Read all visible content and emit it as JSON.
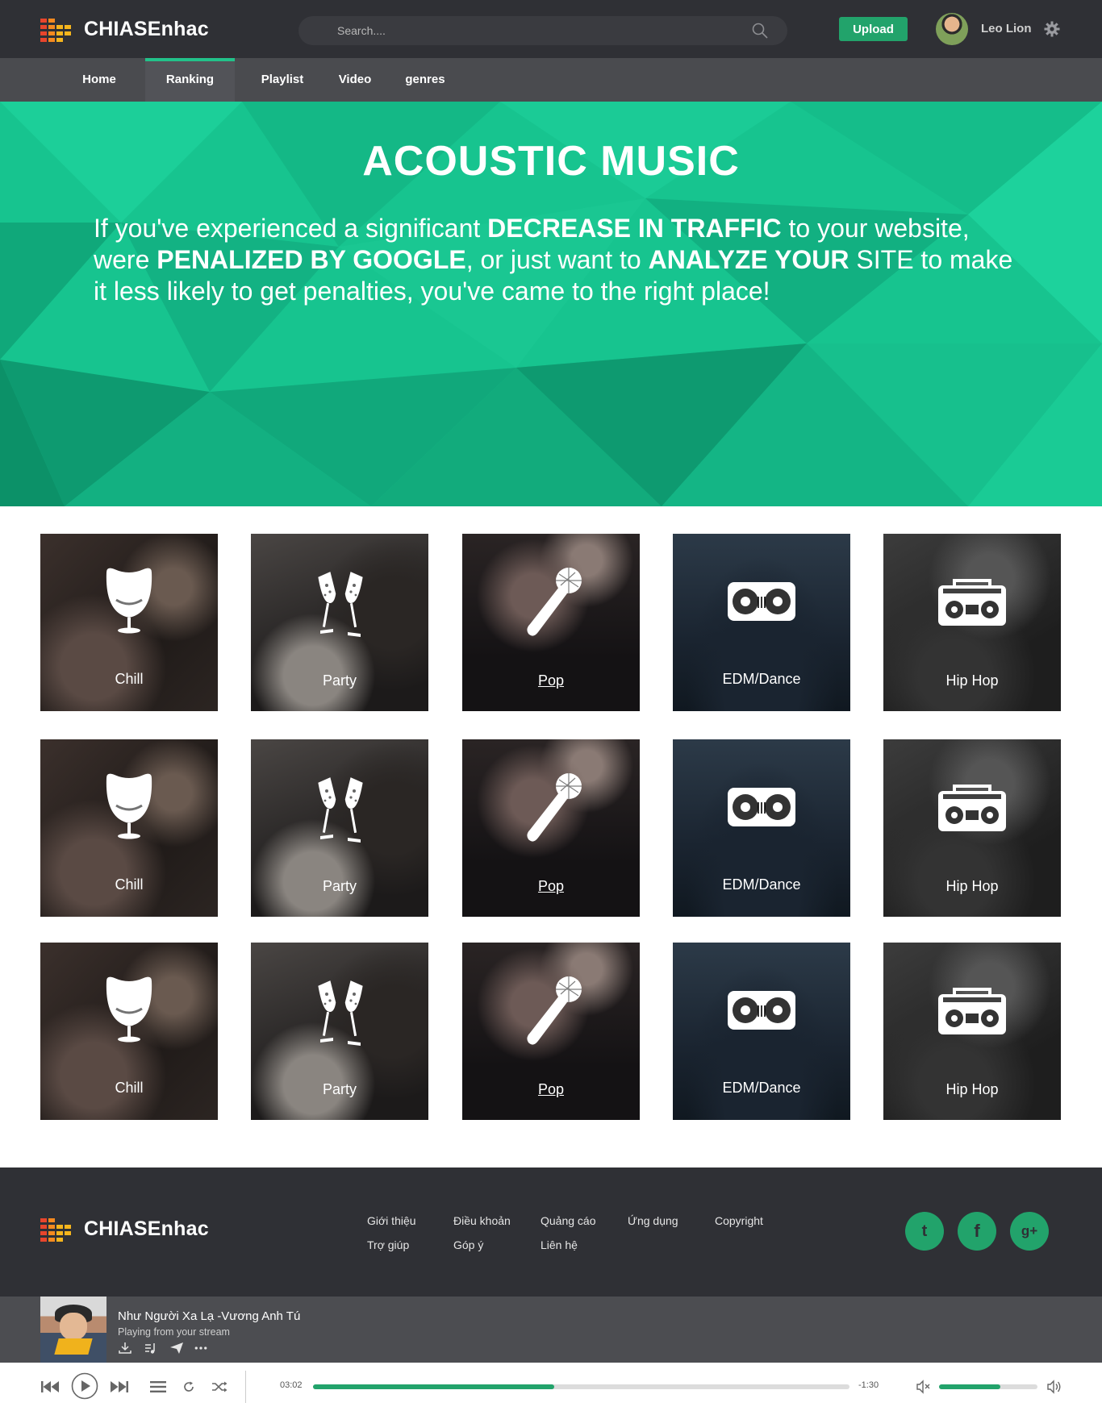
{
  "brand": {
    "name": "CHIASEnhac",
    "logo_colors": [
      "#e8452c",
      "#f58a1f",
      "#f5b51d"
    ]
  },
  "header": {
    "search_placeholder": "Search....",
    "upload_label": "Upload",
    "user_name": "Leo Lion"
  },
  "nav": {
    "items": [
      {
        "label": "Home"
      },
      {
        "label": "Ranking"
      },
      {
        "label": "Playlist"
      },
      {
        "label": "Video"
      },
      {
        "label": "genres"
      }
    ],
    "active": "Ranking"
  },
  "hero": {
    "title": "ACOUSTIC MUSIC",
    "t1": "If you've experienced a significant ",
    "b1": "DECREASE IN TRAFFIC",
    "t2": " to your website, were ",
    "b2": "PENALIZED BY GOOGLE",
    "t3": ", or just want to ",
    "b3": "ANALYZE YOUR",
    "t4": " SITE to make it less likely to get penalties, you've came to the right place!"
  },
  "genres": {
    "rows": [
      [
        "Chill",
        "Party",
        "Pop",
        "EDM/Dance",
        "Hip Hop"
      ],
      [
        "Chill",
        "Party",
        "Pop",
        "EDM/Dance",
        "Hip Hop"
      ],
      [
        "Chill",
        "Party",
        "Pop",
        "EDM/Dance",
        "Hip Hop"
      ]
    ],
    "icons": [
      "egg-chair-icon",
      "champagne-glasses-icon",
      "microphone-icon",
      "dj-turntable-icon",
      "boombox-icon"
    ]
  },
  "footer": {
    "links": [
      "Giới thiệu",
      "Trợ giúp",
      "Điều khoản",
      "Góp ý",
      "Quảng cáo",
      "Liên hệ",
      "Ứng dụng",
      "Copyright"
    ],
    "social": [
      "twitter",
      "facebook",
      "google-plus"
    ],
    "social_glyphs": [
      "t",
      "f",
      "g+"
    ]
  },
  "player": {
    "song_title": "Như Người Xa Lạ -Vương Anh Tú",
    "subtitle": "Playing from your stream",
    "elapsed": "03:02",
    "remaining": "-1:30",
    "progress": 0.45,
    "volume": 0.62
  },
  "colors": {
    "accent": "#22a36b",
    "hero": "#17c48f",
    "dark": "#2f3035"
  }
}
